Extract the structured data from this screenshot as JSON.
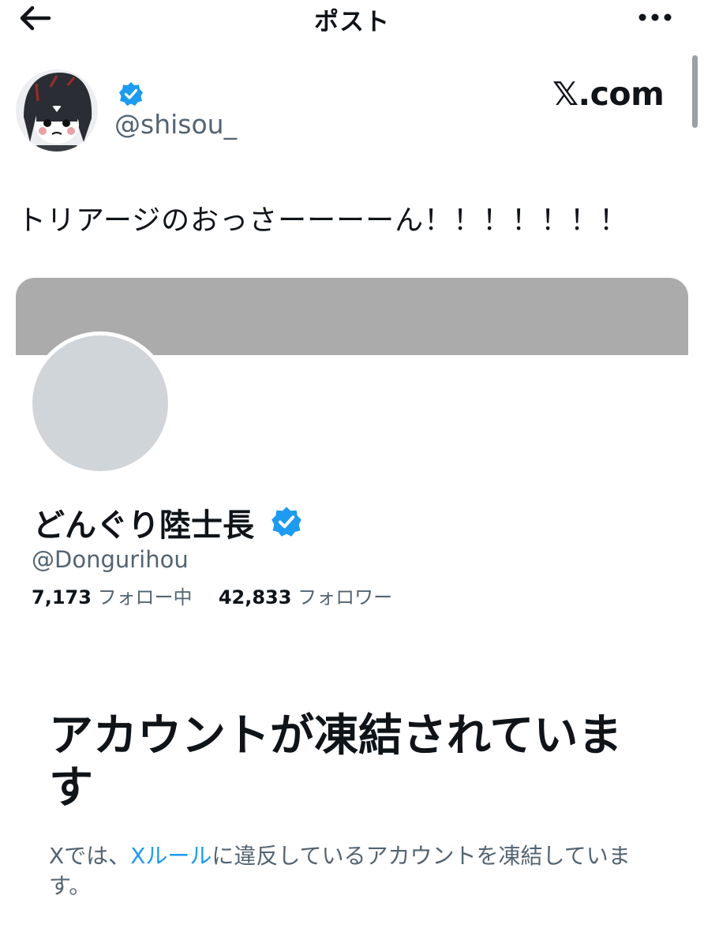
{
  "header": {
    "title": "ポスト",
    "back_icon": "arrow-left-icon",
    "more_icon": "ellipsis-icon"
  },
  "post": {
    "handle": "@shisou_",
    "verified_icon": "verified-badge-icon",
    "brand": "𝕏.com",
    "text": "トリアージのおっさーーーーん！！！！！！！"
  },
  "profile_card": {
    "name": "どんぐり陸士長",
    "handle": "@Dongurihou",
    "following_count": "7,173",
    "following_label": "フォロー中",
    "followers_count": "42,833",
    "followers_label": "フォロワー"
  },
  "suspended": {
    "title": "アカウントが凍結されています",
    "desc_prefix": "Xでは、",
    "desc_link": "Xルール",
    "desc_suffix": "に違反しているアカウントを凍結しています。"
  },
  "colors": {
    "accent": "#1d9bf0",
    "text": "#0f1419",
    "secondary": "#536471",
    "banner": "#ababab",
    "avatar_placeholder": "#d0d5da"
  }
}
